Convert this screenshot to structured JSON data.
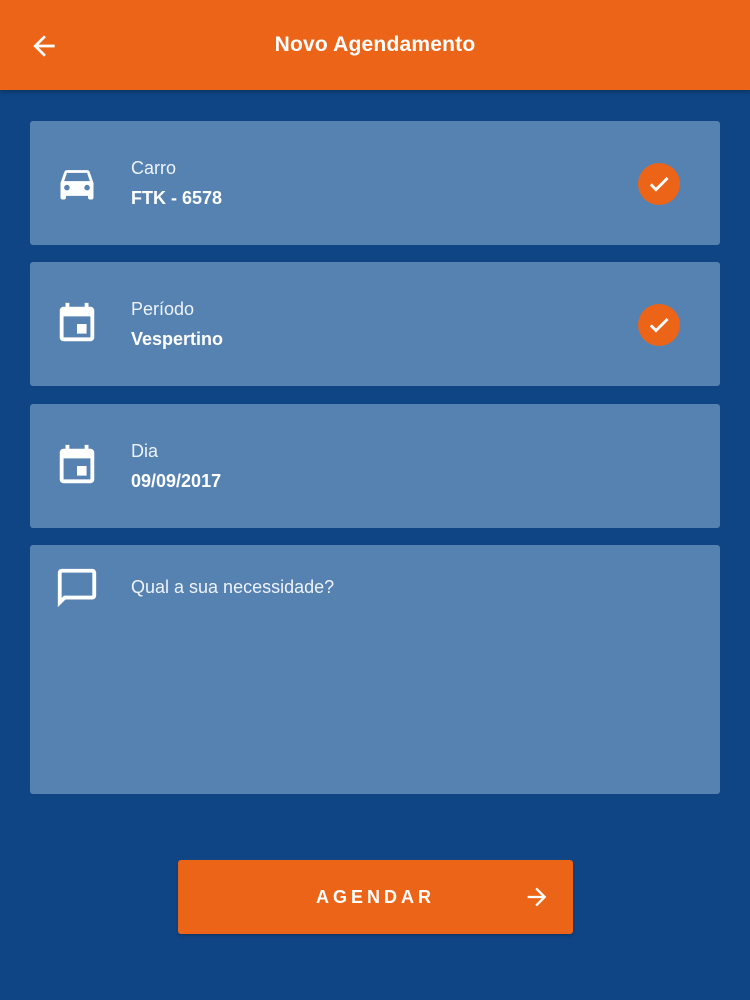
{
  "appbar": {
    "title": "Novo Agendamento",
    "back_icon": "arrow-left-icon",
    "color": "#ec6417"
  },
  "background_color": "#0f4585",
  "card_color": "#5682b2",
  "fields": [
    {
      "icon": "car-icon",
      "label": "Carro",
      "value": "FTK - 6578",
      "checked": true
    },
    {
      "icon": "calendar-icon",
      "label": "Período",
      "value": "Vespertino",
      "checked": true
    },
    {
      "icon": "calendar-icon",
      "label": "Dia",
      "value": "09/09/2017",
      "checked": false
    }
  ],
  "need": {
    "icon": "message-icon",
    "placeholder": "Qual a sua necessidade?",
    "value": ""
  },
  "submit": {
    "label": "AGENDAR",
    "icon": "arrow-right-icon"
  }
}
